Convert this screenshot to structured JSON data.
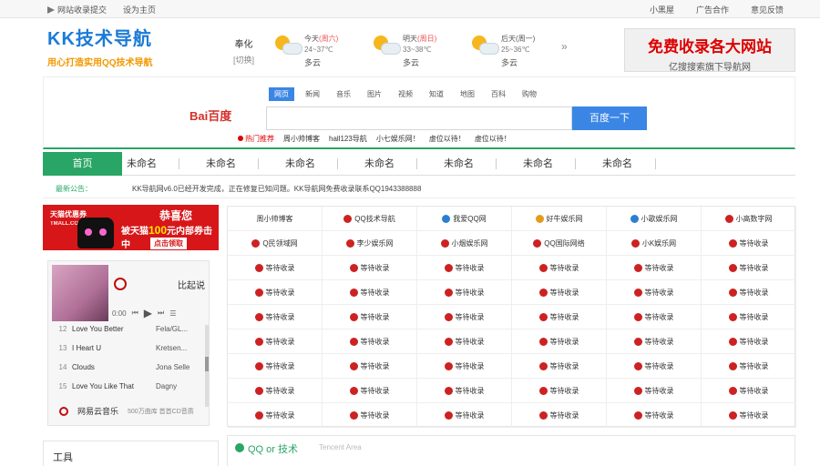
{
  "topbar": {
    "left": [
      "网站收录提交",
      "设为主页"
    ],
    "right": [
      "小黑屋",
      "广告合作",
      "意见反馈"
    ]
  },
  "logo": {
    "title": "KK技术导航",
    "slogan": "用心打造实用QQ技术导航"
  },
  "location": {
    "city": "奉化",
    "switch": "[切换]"
  },
  "weather": [
    {
      "day": "今天",
      "week": "(周六)",
      "temp": "24~37℃",
      "cond": "多云"
    },
    {
      "day": "明天",
      "week": "(周日)",
      "temp": "33~38℃",
      "cond": "多云"
    },
    {
      "day": "后天",
      "week": "(周一)",
      "temp": "25~36℃",
      "cond": "多云"
    }
  ],
  "ad": {
    "line1": "免费收录各大网站",
    "line2": "亿搜搜索旗下导航网"
  },
  "search": {
    "tabs": [
      "网页",
      "新闻",
      "音乐",
      "图片",
      "视频",
      "知道",
      "地图",
      "百科",
      "购物"
    ],
    "active_tab": 0,
    "engine": "Bai百度",
    "button": "百度一下",
    "value": "",
    "hot_label": "热门推荐",
    "hot": [
      "周小帅博客",
      "hall123导航",
      "小七娱乐网！",
      "虚位以待！",
      "虚位以待！"
    ]
  },
  "nav": [
    "首页",
    "未命名",
    "未命名",
    "未命名",
    "未命名",
    "未命名",
    "未命名",
    "未命名"
  ],
  "notice": {
    "label": "最新公告：",
    "text": "KK导航网v6.0已经开发完成，正在修复已知问题。KK导航网免费收录联系QQ1943388888"
  },
  "tmall": {
    "coupon": "天猫优惠券",
    "domain": "TMALL.COM",
    "congrats": "恭喜您",
    "prize_pre": "被天猫",
    "prize_amt": "100",
    "prize_post": "元内部券击中",
    "cta": "点击领取"
  },
  "player": {
    "title": "比起说",
    "time": "0:00",
    "songs": [
      {
        "no": "12",
        "name": "Love You Better",
        "artist": "Fela/GL..."
      },
      {
        "no": "13",
        "name": "I Heart U",
        "artist": "Kretsen..."
      },
      {
        "no": "14",
        "name": "Clouds",
        "artist": "Jona Selle"
      },
      {
        "no": "15",
        "name": "Love You Like That",
        "artist": "Dagny"
      }
    ],
    "brand": "网易云音乐",
    "brand_sub": "500万曲库 首首CD音质"
  },
  "tools_title": "工具",
  "links": [
    [
      {
        "t": "周小帅博客",
        "i": "none"
      },
      {
        "t": "QQ技术导航",
        "i": "qq"
      },
      {
        "t": "我爱QQ网",
        "i": "blue"
      },
      {
        "t": "好牛娱乐网",
        "i": "dk"
      },
      {
        "t": "小歌娱乐网",
        "i": "blue"
      },
      {
        "t": "小高数字网",
        "i": "qq"
      }
    ],
    [
      {
        "t": "Q民领域网",
        "i": "qq"
      },
      {
        "t": "李少娱乐网",
        "i": "qq"
      },
      {
        "t": "小烟娱乐网",
        "i": "qq"
      },
      {
        "t": "QQ国际网络",
        "i": "qq"
      },
      {
        "t": "小K娱乐网",
        "i": "qq"
      },
      {
        "t": "等待收录",
        "i": "qq"
      }
    ],
    [
      {
        "t": "等待收录",
        "i": "qq"
      },
      {
        "t": "等待收录",
        "i": "qq"
      },
      {
        "t": "等待收录",
        "i": "qq"
      },
      {
        "t": "等待收录",
        "i": "qq"
      },
      {
        "t": "等待收录",
        "i": "qq"
      },
      {
        "t": "等待收录",
        "i": "qq"
      }
    ],
    [
      {
        "t": "等待收录",
        "i": "qq"
      },
      {
        "t": "等待收录",
        "i": "qq"
      },
      {
        "t": "等待收录",
        "i": "qq"
      },
      {
        "t": "等待收录",
        "i": "qq"
      },
      {
        "t": "等待收录",
        "i": "qq"
      },
      {
        "t": "等待收录",
        "i": "qq"
      }
    ],
    [
      {
        "t": "等待收录",
        "i": "qq"
      },
      {
        "t": "等待收录",
        "i": "qq"
      },
      {
        "t": "等待收录",
        "i": "qq"
      },
      {
        "t": "等待收录",
        "i": "qq"
      },
      {
        "t": "等待收录",
        "i": "qq"
      },
      {
        "t": "等待收录",
        "i": "qq"
      }
    ],
    [
      {
        "t": "等待收录",
        "i": "qq"
      },
      {
        "t": "等待收录",
        "i": "qq"
      },
      {
        "t": "等待收录",
        "i": "qq"
      },
      {
        "t": "等待收录",
        "i": "qq"
      },
      {
        "t": "等待收录",
        "i": "qq"
      },
      {
        "t": "等待收录",
        "i": "qq"
      }
    ],
    [
      {
        "t": "等待收录",
        "i": "qq"
      },
      {
        "t": "等待收录",
        "i": "qq"
      },
      {
        "t": "等待收录",
        "i": "qq"
      },
      {
        "t": "等待收录",
        "i": "qq"
      },
      {
        "t": "等待收录",
        "i": "qq"
      },
      {
        "t": "等待收录",
        "i": "qq"
      }
    ],
    [
      {
        "t": "等待收录",
        "i": "qq"
      },
      {
        "t": "等待收录",
        "i": "qq"
      },
      {
        "t": "等待收录",
        "i": "qq"
      },
      {
        "t": "等待收录",
        "i": "qq"
      },
      {
        "t": "等待收录",
        "i": "qq"
      },
      {
        "t": "等待收录",
        "i": "qq"
      }
    ],
    [
      {
        "t": "等待收录",
        "i": "qq"
      },
      {
        "t": "等待收录",
        "i": "qq"
      },
      {
        "t": "等待收录",
        "i": "qq"
      },
      {
        "t": "等待收录",
        "i": "qq"
      },
      {
        "t": "等待收录",
        "i": "qq"
      },
      {
        "t": "等待收录",
        "i": "qq"
      }
    ]
  ],
  "qq_section": {
    "title": "QQ or 技术",
    "sub": "Tencent Area"
  }
}
